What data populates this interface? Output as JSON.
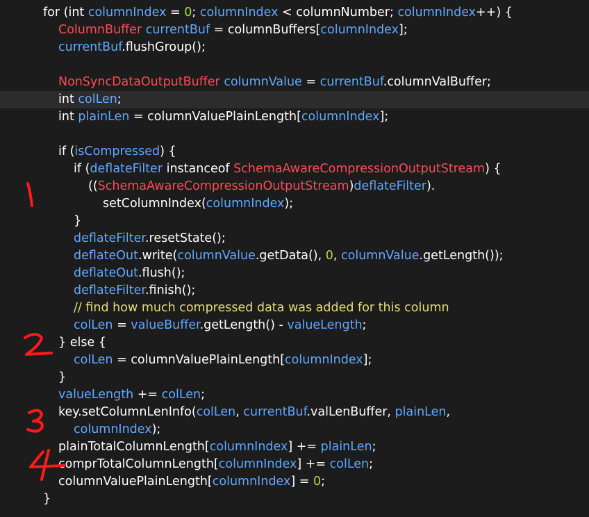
{
  "colors": {
    "background": "#1c1c1c",
    "current_line": "#2c2c2c",
    "plain": "#ffffff",
    "type": "#ff4a55",
    "var": "#5fa8ff",
    "number": "#a6e22e",
    "comment": "#e6db74",
    "annotation": "#ff1a1a"
  },
  "code": {
    "lines": [
      {
        "tokens": [
          [
            "pl",
            "for (int "
          ],
          [
            "var",
            "columnIndex"
          ],
          [
            "pl",
            " = "
          ],
          [
            "num",
            "0"
          ],
          [
            "pl",
            "; "
          ],
          [
            "var",
            "columnIndex"
          ],
          [
            "pl",
            " < columnNumber; "
          ],
          [
            "var",
            "columnIndex"
          ],
          [
            "pl",
            "++) {"
          ]
        ]
      },
      {
        "tokens": [
          [
            "type",
            "ColumnBuffer"
          ],
          [
            "pl",
            " "
          ],
          [
            "var",
            "currentBuf"
          ],
          [
            "pl",
            " = columnBuffers["
          ],
          [
            "var",
            "columnIndex"
          ],
          [
            "pl",
            "];"
          ]
        ]
      },
      {
        "tokens": [
          [
            "var",
            "currentBuf"
          ],
          [
            "pl",
            ".flushGroup();"
          ]
        ]
      },
      {
        "tokens": []
      },
      {
        "tokens": [
          [
            "type",
            "NonSyncDataOutputBuffer"
          ],
          [
            "pl",
            " "
          ],
          [
            "var",
            "columnValue"
          ],
          [
            "pl",
            " = "
          ],
          [
            "var",
            "currentBuf"
          ],
          [
            "pl",
            ".columnValBuffer;"
          ]
        ]
      },
      {
        "tokens": [
          [
            "pl",
            "int "
          ],
          [
            "var",
            "colLen"
          ],
          [
            "pl",
            ";"
          ]
        ]
      },
      {
        "tokens": [
          [
            "pl",
            "int "
          ],
          [
            "var",
            "plainLen"
          ],
          [
            "pl",
            " = columnValuePlainLength["
          ],
          [
            "var",
            "columnIndex"
          ],
          [
            "pl",
            "];"
          ]
        ]
      },
      {
        "tokens": []
      },
      {
        "tokens": [
          [
            "pl",
            "if ("
          ],
          [
            "var",
            "isCompressed"
          ],
          [
            "pl",
            ") {"
          ]
        ]
      },
      {
        "tokens": [
          [
            "pl",
            "if ("
          ],
          [
            "var",
            "deflateFilter"
          ],
          [
            "pl",
            " instanceof "
          ],
          [
            "type",
            "SchemaAwareCompressionOutputStream"
          ],
          [
            "pl",
            ") {"
          ]
        ]
      },
      {
        "tokens": [
          [
            "pl",
            "(("
          ],
          [
            "type",
            "SchemaAwareCompressionOutputStream"
          ],
          [
            "pl",
            ")"
          ],
          [
            "var",
            "deflateFilter"
          ],
          [
            "pl",
            ")."
          ]
        ]
      },
      {
        "tokens": [
          [
            "pl",
            "setColumnIndex("
          ],
          [
            "var",
            "columnIndex"
          ],
          [
            "pl",
            ");"
          ]
        ]
      },
      {
        "tokens": [
          [
            "pl",
            "}"
          ]
        ]
      },
      {
        "tokens": [
          [
            "var",
            "deflateFilter"
          ],
          [
            "pl",
            ".resetState();"
          ]
        ]
      },
      {
        "tokens": [
          [
            "var",
            "deflateOut"
          ],
          [
            "pl",
            ".write("
          ],
          [
            "var",
            "columnValue"
          ],
          [
            "pl",
            ".getData(), "
          ],
          [
            "num",
            "0"
          ],
          [
            "pl",
            ", "
          ],
          [
            "var",
            "columnValue"
          ],
          [
            "pl",
            ".getLength());"
          ]
        ]
      },
      {
        "tokens": [
          [
            "var",
            "deflateOut"
          ],
          [
            "pl",
            ".flush();"
          ]
        ]
      },
      {
        "tokens": [
          [
            "var",
            "deflateFilter"
          ],
          [
            "pl",
            ".finish();"
          ]
        ]
      },
      {
        "tokens": [
          [
            "cmt",
            "// find how much compressed data was added for this column"
          ]
        ]
      },
      {
        "tokens": [
          [
            "var",
            "colLen"
          ],
          [
            "pl",
            " = "
          ],
          [
            "var",
            "valueBuffer"
          ],
          [
            "pl",
            ".getLength() - "
          ],
          [
            "var",
            "valueLength"
          ],
          [
            "pl",
            ";"
          ]
        ]
      },
      {
        "tokens": [
          [
            "pl",
            "} else {"
          ]
        ]
      },
      {
        "tokens": [
          [
            "var",
            "colLen"
          ],
          [
            "pl",
            " = columnValuePlainLength["
          ],
          [
            "var",
            "columnIndex"
          ],
          [
            "pl",
            "];"
          ]
        ]
      },
      {
        "tokens": [
          [
            "pl",
            "}"
          ]
        ]
      },
      {
        "tokens": [
          [
            "var",
            "valueLength"
          ],
          [
            "pl",
            " += "
          ],
          [
            "var",
            "colLen"
          ],
          [
            "pl",
            ";"
          ]
        ]
      },
      {
        "tokens": [
          [
            "pl",
            "key.setColumnLenInfo("
          ],
          [
            "var",
            "colLen"
          ],
          [
            "pl",
            ", "
          ],
          [
            "var",
            "currentBuf"
          ],
          [
            "pl",
            ".valLenBuffer, "
          ],
          [
            "var",
            "plainLen"
          ],
          [
            "pl",
            ","
          ]
        ]
      },
      {
        "tokens": [
          [
            "var",
            "columnIndex"
          ],
          [
            "pl",
            ");"
          ]
        ]
      },
      {
        "tokens": [
          [
            "pl",
            "plainTotalColumnLength["
          ],
          [
            "var",
            "columnIndex"
          ],
          [
            "pl",
            "] += "
          ],
          [
            "var",
            "plainLen"
          ],
          [
            "pl",
            ";"
          ]
        ]
      },
      {
        "tokens": [
          [
            "pl",
            "comprTotalColumnLength["
          ],
          [
            "var",
            "columnIndex"
          ],
          [
            "pl",
            "] += "
          ],
          [
            "var",
            "colLen"
          ],
          [
            "pl",
            ";"
          ]
        ]
      },
      {
        "tokens": [
          [
            "pl",
            "columnValuePlainLength["
          ],
          [
            "var",
            "columnIndex"
          ],
          [
            "pl",
            "] = "
          ],
          [
            "num",
            "0"
          ],
          [
            "pl",
            ";"
          ]
        ]
      },
      {
        "tokens": [
          [
            "pl",
            "}"
          ]
        ]
      }
    ]
  },
  "annotations": [
    "1",
    "2",
    "3",
    "4"
  ]
}
